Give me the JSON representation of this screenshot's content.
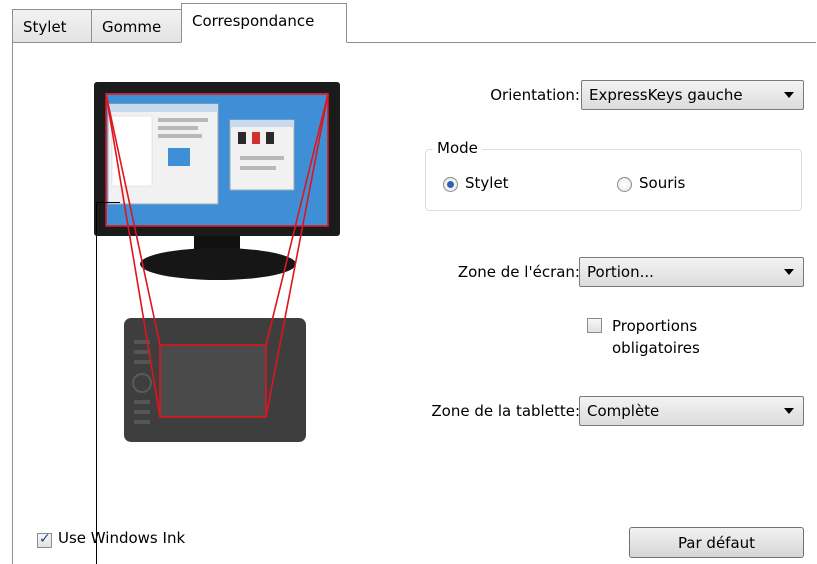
{
  "tabs": [
    {
      "label": "Stylet",
      "active": false
    },
    {
      "label": "Gomme",
      "active": false
    },
    {
      "label": "Correspondance",
      "active": true
    }
  ],
  "orientation": {
    "label": "Orientation:",
    "value": "ExpressKeys gauche"
  },
  "mode": {
    "title": "Mode",
    "options": [
      {
        "label": "Stylet",
        "checked": true
      },
      {
        "label": "Souris",
        "checked": false
      }
    ]
  },
  "screen_area": {
    "label": "Zone de l'écran:",
    "value": "Portion..."
  },
  "proportions": {
    "label_line1": "Proportions",
    "label_line2": "obligatoires",
    "checked": false
  },
  "tablet_area": {
    "label": "Zone de la tablette:",
    "value": "Complète"
  },
  "windows_ink": {
    "label": "Use Windows Ink",
    "checked": true
  },
  "default_button": {
    "label": "Par défaut"
  },
  "colors": {
    "mapping_outline": "#e0141e",
    "desktop_blue": "#3f8fd7",
    "monitor_frame": "#1b1b1b",
    "tablet_body": "#3e3e3e"
  },
  "icons": [
    "caret-down-icon",
    "radio-icon",
    "checkbox-icon"
  ]
}
